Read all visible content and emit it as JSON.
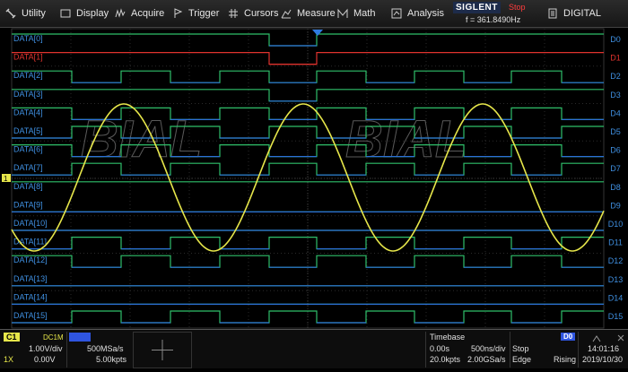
{
  "menu": [
    {
      "label": "Utility",
      "icon": "utility-icon"
    },
    {
      "label": "Display",
      "icon": "display-icon"
    },
    {
      "label": "Acquire",
      "icon": "acquire-icon"
    },
    {
      "label": "Trigger",
      "icon": "trigger-icon"
    },
    {
      "label": "Cursors",
      "icon": "cursors-icon"
    },
    {
      "label": "Measure",
      "icon": "measure-icon"
    },
    {
      "label": "Math",
      "icon": "math-icon"
    },
    {
      "label": "Analysis",
      "icon": "analysis-icon"
    },
    {
      "label": "DIGITAL",
      "icon": "digital-icon"
    }
  ],
  "brand": {
    "name": "SIGLENT",
    "run_state": "Stop",
    "frequency": "f = 361.8490Hz"
  },
  "watermark": "BIAL",
  "digital": {
    "left_labels": [
      "DATA[0]",
      "DATA[1]",
      "DATA[2]",
      "DATA[3]",
      "DATA[4]",
      "DATA[5]",
      "DATA[6]",
      "DATA[7]",
      "DATA[8]",
      "DATA[9]",
      "DATA[10]",
      "DATA[11]",
      "DATA[12]",
      "DATA[13]",
      "DATA[14]",
      "DATA[15]"
    ],
    "right_labels": [
      "D0",
      "D1",
      "D2",
      "D3",
      "D4",
      "D5",
      "D6",
      "D7",
      "D8",
      "D9",
      "D10",
      "D11",
      "D12",
      "D13",
      "D14",
      "D15"
    ],
    "highlight_channel": 1,
    "colors": {
      "high": "#2fbf6a",
      "low": "#2c6fd6",
      "highlight": "#e0332e",
      "label": "#3f8fe0"
    }
  },
  "analog": {
    "channel_marker": "1",
    "color": "#e6e64a",
    "periods_visible": 3.3
  },
  "status": {
    "c1": {
      "tag": "C1",
      "coupling": "DC1M",
      "scale": "1.00V/div",
      "probe": "1X",
      "offset": "0.00V"
    },
    "digital_tag": "D",
    "sample": {
      "rate": "500MSa/s",
      "points": "5.00kpts"
    },
    "timebase": {
      "title": "Timebase",
      "delay": "0.00s",
      "scale": "500ns/div",
      "points": "20.0kpts",
      "rate": "2.00GSa/s"
    },
    "trigger": {
      "tag": "D0",
      "mode": "Stop",
      "type": "Edge",
      "slope": "Rising"
    },
    "clock": {
      "time": "14:01:16",
      "date": "2019/10/30"
    }
  }
}
